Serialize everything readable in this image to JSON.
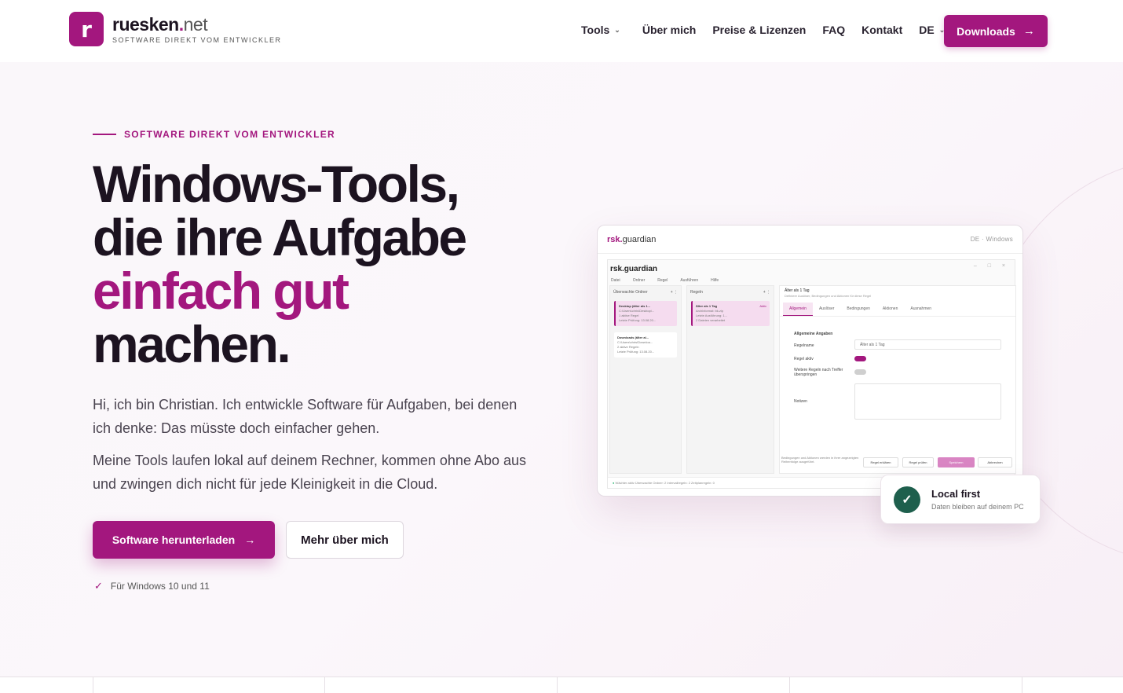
{
  "header": {
    "logo_letter": "r",
    "logo_name": "ruesken",
    "logo_dot": ".",
    "logo_tld": "net",
    "logo_tagline": "SOFTWARE DIREKT VOM ENTWICKLER",
    "nav": [
      {
        "label": "Tools",
        "has_dropdown": true
      },
      {
        "label": "Über mich"
      },
      {
        "label": "Preise & Lizenzen"
      },
      {
        "label": "FAQ"
      },
      {
        "label": "Kontakt"
      },
      {
        "label": "DE",
        "has_dropdown": true
      }
    ],
    "downloads_label": "Downloads"
  },
  "hero": {
    "eyebrow": "SOFTWARE DIREKT VOM ENTWICKLER",
    "headline_line1": "Windows-Tools,",
    "headline_line2": "die ihre Aufgabe",
    "headline_accent": "einfach gut",
    "headline_line4": "machen.",
    "paragraph1": "Hi, ich bin Christian. Ich entwickle Software für Aufgaben, bei denen ich denke: Das müsste doch einfacher gehen.",
    "paragraph2": "Meine Tools laufen lokal auf deinem Rechner, kommen ohne Abo aus und zwingen dich nicht für jede Kleinigkeit in die Cloud.",
    "primary_button": "Software herunterladen",
    "secondary_button": "Mehr über mich",
    "compat_note": "Für Windows 10 und 11"
  },
  "mockup": {
    "brand_bold": "rsk.",
    "brand_rest": "guardian",
    "meta": "DE · Windows",
    "app_title": "rsk.guardian",
    "menu": [
      "Datei",
      "Ordner",
      "Regel",
      "Ausführen",
      "Hilfe"
    ],
    "pane_folders_title": "Überwachte Ordner",
    "pane_rules_title": "Regeln",
    "folder_cards": [
      {
        "title": "Desktop (älter als 1...",
        "line1": "C:\\Users\\chris\\Desktop\\...",
        "line2": "1 aktive Regel",
        "line3": "Letzte Prüfung: 13.08.20..."
      },
      {
        "title": "Downloads (älter al...",
        "line1": "C:\\Users\\chris\\Downloa...",
        "line2": "2 aktive Regeln",
        "line3": "Letzte Prüfung: 13.08.20..."
      }
    ],
    "rule_card": {
      "title": "Älter als 1 Tag",
      "status": "Aktiv",
      "line1": "Archivformat: bk.zip",
      "line2": "Letzte Ausführung: 1...",
      "line3": "2 Dateien verarbeitet"
    },
    "detail_title": "Älter als 1 Tag",
    "detail_sub": "Definiere Auslöser, Bedingungen und Aktionen für diese Regel",
    "tabs": [
      "Allgemein",
      "Auslöser",
      "Bedingungen",
      "Aktionen",
      "Ausnahmen"
    ],
    "section_title": "Allgemeine Angaben",
    "field_rulename_label": "Regelname",
    "field_rulename_value": "Älter als 1 Tag",
    "field_active_label": "Regel aktiv",
    "field_skip_label": "Weitere Regeln nach Treffer überspringen",
    "field_notes_label": "Notizen",
    "footer_note": "Bedingungen und Aktionen werden in ihrer angezeigten Reihenfolge ausgeführt.",
    "buttons": [
      "Regel erklären",
      "Regel prüfen",
      "Speichern",
      "Abbrechen"
    ],
    "statusbar": "Wächter aktiv   Überwachte Ordner: 2   Intervallregeln: 2   Zeitplanregeln: 0"
  },
  "badge": {
    "title": "Local first",
    "subtitle": "Daten bleiben auf deinem PC"
  },
  "colors": {
    "accent": "#a3177e",
    "badge_icon": "#1e5f4d",
    "text": "#1c1320"
  }
}
